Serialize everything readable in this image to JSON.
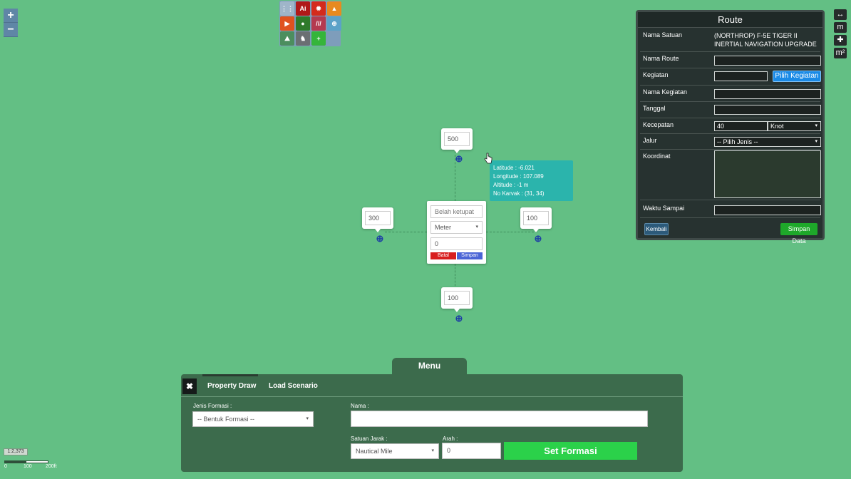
{
  "zoom": {
    "in": "+",
    "out": "−"
  },
  "tools": [
    {
      "icon": "grid-dots-icon",
      "glyph": "⋮⋮",
      "color": "#9fb5c9"
    },
    {
      "icon": "ai-file-icon",
      "glyph": "Ai",
      "color": "#b01818"
    },
    {
      "icon": "red-gear-icon",
      "glyph": "✹",
      "color": "#d42a1c"
    },
    {
      "icon": "tent-icon",
      "glyph": "▲",
      "color": "#e78a1f"
    },
    {
      "icon": "video-icon",
      "glyph": "▶",
      "color": "#e0521f"
    },
    {
      "icon": "tree-icon",
      "glyph": "●",
      "color": "#2f7a2a"
    },
    {
      "icon": "barbed-wire-icon",
      "glyph": "///",
      "color": "#b43a50"
    },
    {
      "icon": "world-map-icon",
      "glyph": "⊕",
      "color": "#5ba2c8"
    },
    {
      "icon": "landscape-icon",
      "glyph": "⛰",
      "color": "#4c8e5e"
    },
    {
      "icon": "soldier-icon",
      "glyph": "♞",
      "color": "#6b6f73"
    },
    {
      "icon": "add-icon",
      "glyph": "+",
      "color": "#35b53a"
    }
  ],
  "route": {
    "title": "Route",
    "nama_satuan_label": "Nama Satuan",
    "nama_satuan_value": "(NORTHROP) F-5E TIGER II INERTIAL NAVIGATION UPGRADE",
    "nama_route_label": "Nama Route",
    "kegiatan_label": "Kegiatan",
    "pilih_kegiatan": "Pilih Kegiatan",
    "nama_kegiatan_label": "Nama Kegiatan",
    "tanggal_label": "Tanggal",
    "kecepatan_label": "Kecepatan",
    "kecepatan_value": "40",
    "kecepatan_unit": "Knot",
    "jalur_label": "Jalur",
    "jalur_value": "-- Pilih Jenis --",
    "koordinat_label": "Koordinat",
    "waktu_sampai_label": "Waktu Sampai",
    "kembali": "Kembali",
    "simpan_data": "Simpan Data"
  },
  "side_controls": [
    {
      "icon": "measure-distance-icon",
      "glyph": "↔"
    },
    {
      "icon": "meter-icon",
      "glyph": "m"
    },
    {
      "icon": "move-icon",
      "glyph": "✚"
    },
    {
      "icon": "area-icon",
      "glyph": "m²"
    }
  ],
  "formation": {
    "top_value": "500",
    "left_value": "300",
    "right_value": "100",
    "bottom_value": "100",
    "center": {
      "placeholder": "Belah ketupat",
      "unit": "Meter",
      "value": "0",
      "batal": "Batal",
      "simpan": "Simpan"
    }
  },
  "tooltip": {
    "latitude": "Latitude : -6.021",
    "longitude": "Longitude : 107.089",
    "altitude": "Altitude : -1 m",
    "no_karvak": "No Karvak : (31, 34)"
  },
  "menu": {
    "title": "Menu",
    "close": "✖",
    "tabs": [
      "Property Draw",
      "Load Scenario"
    ],
    "jenis_formasi_label": "Jenis Formasi :",
    "jenis_formasi_value": "-- Bentuk Formasi --",
    "nama_label": "Nama :",
    "satuan_jarak_label": "Satuan Jarak :",
    "satuan_jarak_value": "Nautical Mile",
    "arah_label": "Arah :",
    "arah_value": "0",
    "set_formasi": "Set Formasi"
  },
  "scale": {
    "ratio": "1:2,373",
    "labels": [
      "0",
      "100",
      "200ft"
    ]
  }
}
